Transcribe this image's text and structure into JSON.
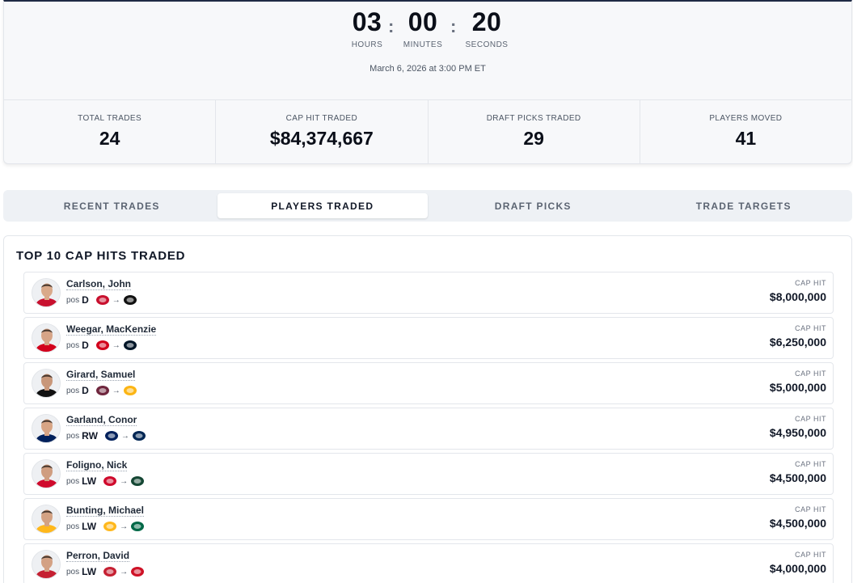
{
  "countdown": {
    "hours": "03",
    "hours_label": "HOURS",
    "minutes": "00",
    "minutes_label": "MINUTES",
    "seconds": "20",
    "seconds_label": "SECONDS",
    "separator": ":",
    "deadline": "March 6, 2026 at 3:00 PM ET"
  },
  "stats": [
    {
      "label": "TOTAL TRADES",
      "value": "24"
    },
    {
      "label": "CAP HIT TRADED",
      "value": "$84,374,667"
    },
    {
      "label": "DRAFT PICKS TRADED",
      "value": "29"
    },
    {
      "label": "PLAYERS MOVED",
      "value": "41"
    }
  ],
  "tabs": [
    {
      "label": "RECENT TRADES",
      "active": false
    },
    {
      "label": "PLAYERS TRADED",
      "active": true
    },
    {
      "label": "DRAFT PICKS",
      "active": false
    },
    {
      "label": "TRADE TARGETS",
      "active": false
    }
  ],
  "panel": {
    "title": "TOP 10 CAP HITS TRADED",
    "pos_label": "pos",
    "cap_label": "CAP HIT",
    "arrow": "→",
    "players": [
      {
        "name": "Carlson, John",
        "pos": "D",
        "from": "WSH",
        "to": "ANA",
        "cap": "$8,000,000",
        "jersey": "#c8102e",
        "skin": "#d9a98a"
      },
      {
        "name": "Weegar, MacKenzie",
        "pos": "D",
        "from": "CGY",
        "to": "SEA",
        "cap": "$6,250,000",
        "jersey": "#d2001c",
        "skin": "#d6a487"
      },
      {
        "name": "Girard, Samuel",
        "pos": "D",
        "from": "COL",
        "to": "PIT",
        "cap": "$5,000,000",
        "jersey": "#111111",
        "skin": "#c8977a"
      },
      {
        "name": "Garland, Conor",
        "pos": "RW",
        "from": "VAN",
        "to": "CBJ",
        "cap": "$4,950,000",
        "jersey": "#00205b",
        "skin": "#d8a585"
      },
      {
        "name": "Foligno, Nick",
        "pos": "LW",
        "from": "CHI",
        "to": "MIN",
        "cap": "$4,500,000",
        "jersey": "#cf0a2c",
        "skin": "#cf9d80"
      },
      {
        "name": "Bunting, Michael",
        "pos": "LW",
        "from": "NSH",
        "to": "DAL",
        "cap": "$4,500,000",
        "jersey": "#ffb81c",
        "skin": "#d4a283"
      },
      {
        "name": "Perron, David",
        "pos": "LW",
        "from": "OTT",
        "to": "DET",
        "cap": "$4,000,000",
        "jersey": "#c52032",
        "skin": "#d3a184"
      }
    ]
  },
  "team_colors": {
    "WSH": "#c8102e",
    "ANA": "#111111",
    "CGY": "#d2001c",
    "SEA": "#001628",
    "COL": "#6f263d",
    "PIT": "#fcb514",
    "VAN": "#00205b",
    "CBJ": "#002654",
    "CHI": "#cf0a2c",
    "MIN": "#154734",
    "NSH": "#ffb81c",
    "DAL": "#006847",
    "OTT": "#c52032",
    "DET": "#ce1126"
  }
}
